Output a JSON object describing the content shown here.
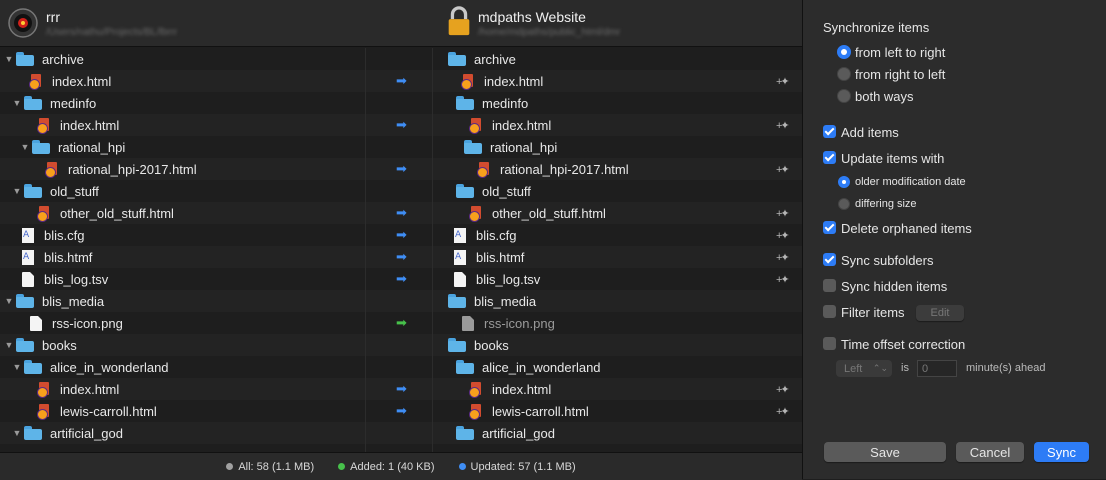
{
  "header": {
    "left": {
      "title": "rrr",
      "path": "/Users/nathu/Projects/BL/lbrrr"
    },
    "right": {
      "title": "mdpaths Website",
      "path": "/home/mdpaths/public_html/dmr"
    }
  },
  "tree_rows": [
    {
      "type": "folder",
      "depth": 0,
      "name": "archive",
      "action": ""
    },
    {
      "type": "html",
      "depth": 1,
      "name": "index.html",
      "action": "blue"
    },
    {
      "type": "folder",
      "depth": 1,
      "name": "medinfo",
      "action": ""
    },
    {
      "type": "html",
      "depth": 2,
      "name": "index.html",
      "action": "blue"
    },
    {
      "type": "folder",
      "depth": 2,
      "name": "rational_hpi",
      "action": ""
    },
    {
      "type": "html",
      "depth": 3,
      "name": "rational_hpi-2017.html",
      "action": "blue"
    },
    {
      "type": "folder",
      "depth": 1,
      "name": "old_stuff",
      "action": ""
    },
    {
      "type": "html",
      "depth": 2,
      "name": "other_old_stuff.html",
      "action": "blue"
    },
    {
      "type": "cfg",
      "depth": 0,
      "name": "blis.cfg",
      "action": "blue"
    },
    {
      "type": "cfg",
      "depth": 0,
      "name": "blis.htmf",
      "action": "blue"
    },
    {
      "type": "doc",
      "depth": 0,
      "name": "blis_log.tsv",
      "action": "blue"
    },
    {
      "type": "folder",
      "depth": 0,
      "name": "blis_media",
      "action": ""
    },
    {
      "type": "doc",
      "depth": 1,
      "name": "rss-icon.png",
      "action": "green"
    },
    {
      "type": "folder",
      "depth": 0,
      "name": "books",
      "action": ""
    },
    {
      "type": "folder",
      "depth": 1,
      "name": "alice_in_wonderland",
      "action": ""
    },
    {
      "type": "html",
      "depth": 2,
      "name": "index.html",
      "action": "blue"
    },
    {
      "type": "html",
      "depth": 2,
      "name": "lewis-carroll.html",
      "action": "blue"
    },
    {
      "type": "folder",
      "depth": 1,
      "name": "artificial_god",
      "action": ""
    }
  ],
  "status": {
    "all": "All: 58 (1.1 MB)",
    "added": "Added: 1 (40 KB)",
    "updated": "Updated: 57 (1.1 MB)"
  },
  "panel": {
    "sync_heading": "Synchronize items",
    "dir_left_to_right": "from left to right",
    "dir_right_to_left": "from right to left",
    "dir_both": "both ways",
    "add_items": "Add items",
    "update_items": "Update items with",
    "older_mod_date": "older modification date",
    "differing_size": "differing size",
    "delete_orphaned": "Delete orphaned items",
    "sync_subfolders": "Sync subfolders",
    "sync_hidden": "Sync hidden items",
    "filter_items": "Filter items",
    "edit": "Edit",
    "time_offset": "Time offset correction",
    "offset_side": "Left",
    "offset_is": "is",
    "offset_value": "0",
    "offset_suffix": "minute(s) ahead",
    "save": "Save",
    "cancel": "Cancel",
    "sync": "Sync"
  },
  "colors": {
    "accent": "#2d7cf6",
    "all_dot": "#a0a0a0",
    "added_dot": "#47c14b",
    "updated_dot": "#3f8ef5"
  }
}
